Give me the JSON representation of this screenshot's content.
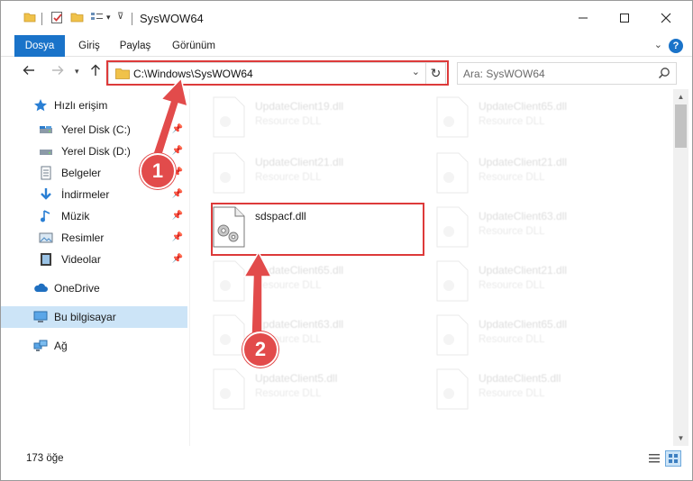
{
  "window": {
    "title": "SysWOW64"
  },
  "ribbon": {
    "tabs": [
      {
        "label": "Dosya"
      },
      {
        "label": "Giriş"
      },
      {
        "label": "Paylaş"
      },
      {
        "label": "Görünüm"
      }
    ],
    "help_label": "?"
  },
  "navbar": {
    "address": "C:\\Windows\\SysWOW64",
    "search_placeholder": "Ara: SysWOW64"
  },
  "sidebar": {
    "items": [
      {
        "label": "Hızlı erişim",
        "icon": "star-icon"
      },
      {
        "label": "Yerel Disk (C:)",
        "icon": "drive-icon"
      },
      {
        "label": "Yerel Disk (D:)",
        "icon": "drive-icon"
      },
      {
        "label": "Belgeler",
        "icon": "documents-icon"
      },
      {
        "label": "İndirmeler",
        "icon": "download-icon"
      },
      {
        "label": "Müzik",
        "icon": "music-icon"
      },
      {
        "label": "Resimler",
        "icon": "pictures-icon"
      },
      {
        "label": "Videolar",
        "icon": "videos-icon"
      },
      {
        "label": "OneDrive",
        "icon": "cloud-icon"
      },
      {
        "label": "Bu bilgisayar",
        "icon": "computer-icon"
      },
      {
        "label": "Ağ",
        "icon": "network-icon"
      }
    ]
  },
  "files": [
    {
      "name": "UpdateClient19.dll",
      "type": "Resource DLL",
      "highlight": false
    },
    {
      "name": "UpdateClient65.dll",
      "type": "Resource DLL",
      "highlight": false
    },
    {
      "name": "UpdateClient21.dll",
      "type": "Resource DLL",
      "highlight": false
    },
    {
      "name": "UpdateClient21.dll",
      "type": "Resource DLL",
      "highlight": false
    },
    {
      "name": "sdspacf.dll",
      "type": "",
      "highlight": true
    },
    {
      "name": "UpdateClient63.dll",
      "type": "Resource DLL",
      "highlight": false
    },
    {
      "name": "UpdateClient65.dll",
      "type": "Resource DLL",
      "highlight": false
    },
    {
      "name": "UpdateClient21.dll",
      "type": "Resource DLL",
      "highlight": false
    },
    {
      "name": "UpdateClient63.dll",
      "type": "Resource DLL",
      "highlight": false
    },
    {
      "name": "UpdateClient65.dll",
      "type": "Resource DLL",
      "highlight": false
    },
    {
      "name": "UpdateClient5.dll",
      "type": "Resource DLL",
      "highlight": false
    },
    {
      "name": "UpdateClient5.dll",
      "type": "Resource DLL",
      "highlight": false
    }
  ],
  "statusbar": {
    "count": "173 öğe"
  },
  "annotations": {
    "badge1": "1",
    "badge2": "2"
  },
  "colors": {
    "accent": "#1a73c9",
    "annotation": "#e24b4b",
    "selection": "#cce4f7"
  }
}
